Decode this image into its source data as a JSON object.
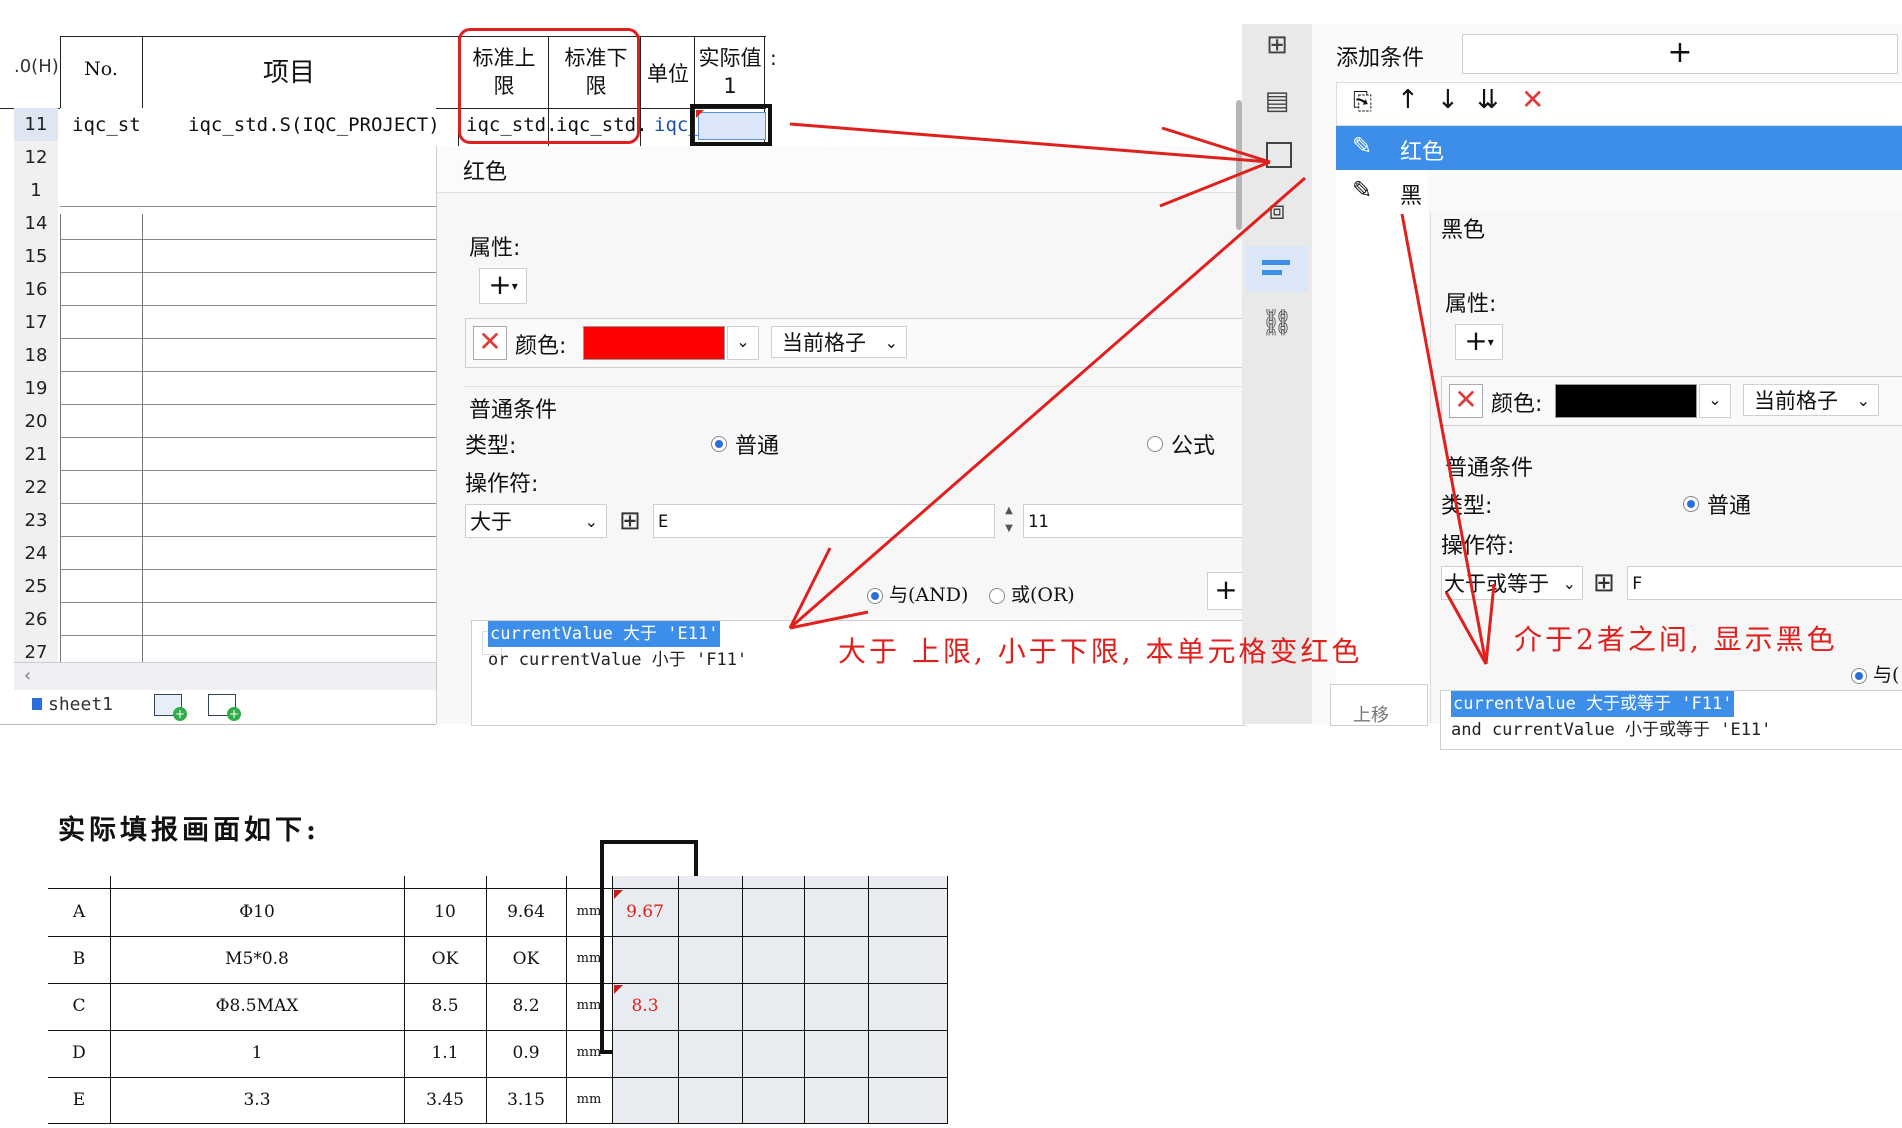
{
  "sheet": {
    "top_left_label": ".0(H)",
    "headers": {
      "no": "No.",
      "item": "项目",
      "upper": "标准上限",
      "lower": "标准下限",
      "unit": "单位",
      "actual": "实际值1",
      "more": ":"
    },
    "row11": {
      "c1": "iqc_st",
      "c2": "iqc_std.S(IQC_PROJECT)",
      "c3": "iqc_std.",
      "c4": "iqc_std.",
      "c5": "iqc_"
    },
    "row_numbers": [
      "11",
      "12",
      "1",
      "14",
      "15",
      "16",
      "17",
      "18",
      "19",
      "20",
      "21",
      "22",
      "23",
      "24",
      "25",
      "26",
      "27"
    ],
    "tab": "sheet1"
  },
  "red_dialog": {
    "title": "红色",
    "attr_label": "属性:",
    "color_label": "颜色:",
    "color_value": "#ff0000",
    "scope": "当前格子",
    "section": "普通条件",
    "type_label": "类型:",
    "type_normal": "普通",
    "type_formula": "公式",
    "op_label": "操作符:",
    "op_value": "大于",
    "col_value": "E",
    "row_value": "11",
    "and_label": "与(AND)",
    "or_label": "或(OR)",
    "cond_line1": "currentValue 大于 'E11'",
    "cond_line2": "or  currentValue 小于 'F11'"
  },
  "right_panel": {
    "add_condition": "添加条件",
    "items": [
      "红色",
      "黑色"
    ],
    "black_title": "黑色",
    "attr_label": "属性:",
    "color_label": "颜色:",
    "color_value": "#000000",
    "scope": "当前格子",
    "section": "普通条件",
    "type_label": "类型:",
    "type_normal": "普通",
    "op_label": "操作符:",
    "op_value": "大于或等于",
    "col_value": "F",
    "and_label": "与(",
    "cond_line1": "currentValue 大于或等于 'F11'",
    "cond_line2": "and currentValue 小于或等于 'E11'",
    "move_up": "上移"
  },
  "annotations": {
    "red_note": "大于 上限, 小于下限, 本单元格变红色",
    "black_note": "介于2者之间, 显示黑色"
  },
  "report": {
    "title": "实际填报画面如下:",
    "rows": [
      {
        "code": "A",
        "item": "Φ10",
        "upper": "10",
        "lower": "9.64",
        "unit": "mm",
        "actual": "9.67"
      },
      {
        "code": "B",
        "item": "M5*0.8",
        "upper": "OK",
        "lower": "OK",
        "unit": "mm",
        "actual": ""
      },
      {
        "code": "C",
        "item": "Φ8.5MAX",
        "upper": "8.5",
        "lower": "8.2",
        "unit": "mm",
        "actual": "8.3"
      },
      {
        "code": "D",
        "item": "1",
        "upper": "1.1",
        "lower": "0.9",
        "unit": "mm",
        "actual": ""
      },
      {
        "code": "E",
        "item": "3.3",
        "upper": "3.45",
        "lower": "3.15",
        "unit": "mm",
        "actual": ""
      }
    ]
  },
  "colors": {
    "accent": "#3d8ee8",
    "annotation": "#e0201d",
    "selected_row": "#3d8ee8",
    "delete": "#e23b3b"
  }
}
